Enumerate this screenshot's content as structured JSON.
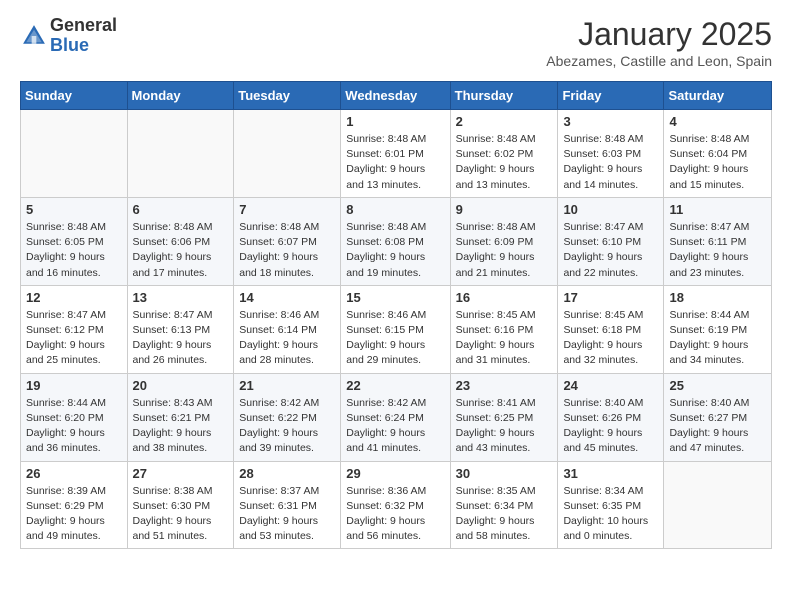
{
  "header": {
    "logo_general": "General",
    "logo_blue": "Blue",
    "month_title": "January 2025",
    "subtitle": "Abezames, Castille and Leon, Spain"
  },
  "weekdays": [
    "Sunday",
    "Monday",
    "Tuesday",
    "Wednesday",
    "Thursday",
    "Friday",
    "Saturday"
  ],
  "weeks": [
    [
      {
        "day": "",
        "info": ""
      },
      {
        "day": "",
        "info": ""
      },
      {
        "day": "",
        "info": ""
      },
      {
        "day": "1",
        "info": "Sunrise: 8:48 AM\nSunset: 6:01 PM\nDaylight: 9 hours and 13 minutes."
      },
      {
        "day": "2",
        "info": "Sunrise: 8:48 AM\nSunset: 6:02 PM\nDaylight: 9 hours and 13 minutes."
      },
      {
        "day": "3",
        "info": "Sunrise: 8:48 AM\nSunset: 6:03 PM\nDaylight: 9 hours and 14 minutes."
      },
      {
        "day": "4",
        "info": "Sunrise: 8:48 AM\nSunset: 6:04 PM\nDaylight: 9 hours and 15 minutes."
      }
    ],
    [
      {
        "day": "5",
        "info": "Sunrise: 8:48 AM\nSunset: 6:05 PM\nDaylight: 9 hours and 16 minutes."
      },
      {
        "day": "6",
        "info": "Sunrise: 8:48 AM\nSunset: 6:06 PM\nDaylight: 9 hours and 17 minutes."
      },
      {
        "day": "7",
        "info": "Sunrise: 8:48 AM\nSunset: 6:07 PM\nDaylight: 9 hours and 18 minutes."
      },
      {
        "day": "8",
        "info": "Sunrise: 8:48 AM\nSunset: 6:08 PM\nDaylight: 9 hours and 19 minutes."
      },
      {
        "day": "9",
        "info": "Sunrise: 8:48 AM\nSunset: 6:09 PM\nDaylight: 9 hours and 21 minutes."
      },
      {
        "day": "10",
        "info": "Sunrise: 8:47 AM\nSunset: 6:10 PM\nDaylight: 9 hours and 22 minutes."
      },
      {
        "day": "11",
        "info": "Sunrise: 8:47 AM\nSunset: 6:11 PM\nDaylight: 9 hours and 23 minutes."
      }
    ],
    [
      {
        "day": "12",
        "info": "Sunrise: 8:47 AM\nSunset: 6:12 PM\nDaylight: 9 hours and 25 minutes."
      },
      {
        "day": "13",
        "info": "Sunrise: 8:47 AM\nSunset: 6:13 PM\nDaylight: 9 hours and 26 minutes."
      },
      {
        "day": "14",
        "info": "Sunrise: 8:46 AM\nSunset: 6:14 PM\nDaylight: 9 hours and 28 minutes."
      },
      {
        "day": "15",
        "info": "Sunrise: 8:46 AM\nSunset: 6:15 PM\nDaylight: 9 hours and 29 minutes."
      },
      {
        "day": "16",
        "info": "Sunrise: 8:45 AM\nSunset: 6:16 PM\nDaylight: 9 hours and 31 minutes."
      },
      {
        "day": "17",
        "info": "Sunrise: 8:45 AM\nSunset: 6:18 PM\nDaylight: 9 hours and 32 minutes."
      },
      {
        "day": "18",
        "info": "Sunrise: 8:44 AM\nSunset: 6:19 PM\nDaylight: 9 hours and 34 minutes."
      }
    ],
    [
      {
        "day": "19",
        "info": "Sunrise: 8:44 AM\nSunset: 6:20 PM\nDaylight: 9 hours and 36 minutes."
      },
      {
        "day": "20",
        "info": "Sunrise: 8:43 AM\nSunset: 6:21 PM\nDaylight: 9 hours and 38 minutes."
      },
      {
        "day": "21",
        "info": "Sunrise: 8:42 AM\nSunset: 6:22 PM\nDaylight: 9 hours and 39 minutes."
      },
      {
        "day": "22",
        "info": "Sunrise: 8:42 AM\nSunset: 6:24 PM\nDaylight: 9 hours and 41 minutes."
      },
      {
        "day": "23",
        "info": "Sunrise: 8:41 AM\nSunset: 6:25 PM\nDaylight: 9 hours and 43 minutes."
      },
      {
        "day": "24",
        "info": "Sunrise: 8:40 AM\nSunset: 6:26 PM\nDaylight: 9 hours and 45 minutes."
      },
      {
        "day": "25",
        "info": "Sunrise: 8:40 AM\nSunset: 6:27 PM\nDaylight: 9 hours and 47 minutes."
      }
    ],
    [
      {
        "day": "26",
        "info": "Sunrise: 8:39 AM\nSunset: 6:29 PM\nDaylight: 9 hours and 49 minutes."
      },
      {
        "day": "27",
        "info": "Sunrise: 8:38 AM\nSunset: 6:30 PM\nDaylight: 9 hours and 51 minutes."
      },
      {
        "day": "28",
        "info": "Sunrise: 8:37 AM\nSunset: 6:31 PM\nDaylight: 9 hours and 53 minutes."
      },
      {
        "day": "29",
        "info": "Sunrise: 8:36 AM\nSunset: 6:32 PM\nDaylight: 9 hours and 56 minutes."
      },
      {
        "day": "30",
        "info": "Sunrise: 8:35 AM\nSunset: 6:34 PM\nDaylight: 9 hours and 58 minutes."
      },
      {
        "day": "31",
        "info": "Sunrise: 8:34 AM\nSunset: 6:35 PM\nDaylight: 10 hours and 0 minutes."
      },
      {
        "day": "",
        "info": ""
      }
    ]
  ]
}
